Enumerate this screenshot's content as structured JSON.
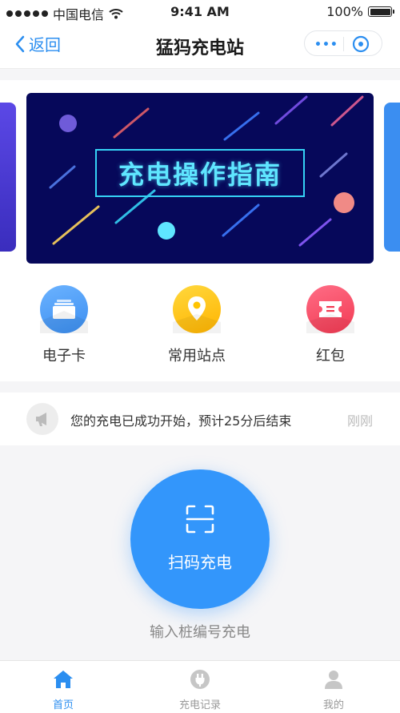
{
  "status_bar": {
    "carrier": "中国电信",
    "time": "9:41 AM",
    "battery": "100%"
  },
  "nav": {
    "back_label": "返回",
    "title": "猛犸充电站",
    "more_label": "•••"
  },
  "banner": {
    "title": "充电操作指南"
  },
  "quick_menu": [
    {
      "label": "电子卡",
      "icon": "card-icon",
      "color": "#3b8ef1"
    },
    {
      "label": "常用站点",
      "icon": "location-pin-icon",
      "color": "#ffc400"
    },
    {
      "label": "红包",
      "icon": "red-packet-icon",
      "color": "#f5465e"
    }
  ],
  "notice": {
    "text": "您的充电已成功开始，预计25分后结束",
    "time": "刚刚",
    "icon": "megaphone-icon"
  },
  "scan": {
    "label": "扫码充电",
    "icon": "scan-icon",
    "input_link": "输入桩编号充电"
  },
  "tabs": [
    {
      "label": "首页",
      "icon": "home-icon",
      "active": true
    },
    {
      "label": "充电记录",
      "icon": "plug-icon",
      "active": false
    },
    {
      "label": "我的",
      "icon": "user-icon",
      "active": false
    }
  ],
  "colors": {
    "accent": "#2b8ef0",
    "scan_button": "#3396fb"
  }
}
